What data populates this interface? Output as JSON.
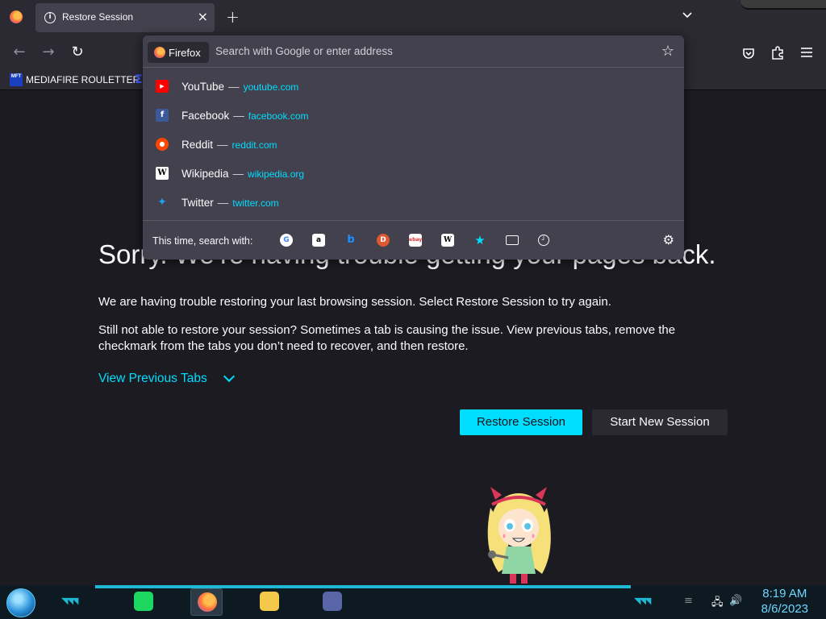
{
  "tab": {
    "title": "Restore Session"
  },
  "bookmarks": {
    "items": [
      {
        "label": "MEDIAFIRE ROULETTER",
        "favicon_text": "MFT"
      }
    ]
  },
  "urlbar": {
    "engine_label": "Firefox",
    "placeholder": "Search with Google or enter address",
    "suggestions": [
      {
        "title": "YouTube",
        "separator": "—",
        "url": "youtube.com",
        "icon": "youtube-icon",
        "color": "#ff0000"
      },
      {
        "title": "Facebook",
        "separator": "—",
        "url": "facebook.com",
        "icon": "facebook-icon",
        "color": "#3b5998"
      },
      {
        "title": "Reddit",
        "separator": "—",
        "url": "reddit.com",
        "icon": "reddit-icon",
        "color": "#ff4500"
      },
      {
        "title": "Wikipedia",
        "separator": "—",
        "url": "wikipedia.org",
        "icon": "wikipedia-icon",
        "color": "#ffffff"
      },
      {
        "title": "Twitter",
        "separator": "—",
        "url": "twitter.com",
        "icon": "twitter-icon",
        "color": "#1da1f2"
      }
    ],
    "footer_label": "This time, search with:",
    "engines": [
      "google",
      "amazon",
      "bing",
      "duckduckgo",
      "ebay",
      "wikipedia",
      "bookmarks",
      "tabs",
      "history"
    ]
  },
  "page": {
    "title": "Sorry. We’re having trouble getting your pages back.",
    "para1": "We are having trouble restoring your last browsing session. Select Restore Session to try again.",
    "para2": "Still not able to restore your session? Sometimes a tab is causing the issue. View previous tabs, remove the checkmark from the tabs you don’t need to recover, and then restore.",
    "view_previous": "View Previous Tabs",
    "restore_button": "Restore Session",
    "new_session_button": "Start New Session"
  },
  "taskbar": {
    "time": "8:19 AM",
    "date": "8/6/2023"
  },
  "colors": {
    "accent": "#00ddff",
    "background": "#1c1b22",
    "toolbar": "#2b2a33",
    "popup": "#42414d"
  }
}
